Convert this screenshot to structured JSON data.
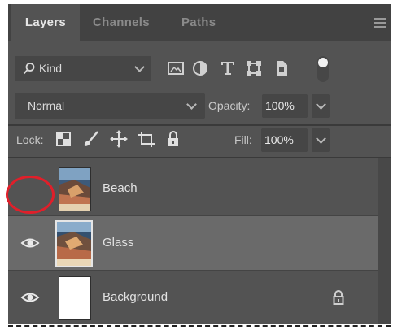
{
  "tabs": {
    "layers": "Layers",
    "channels": "Channels",
    "paths": "Paths"
  },
  "filter": {
    "kind_label": "Kind",
    "icons": [
      "image-filter-icon",
      "adjustment-filter-icon",
      "type-filter-icon",
      "shape-filter-icon",
      "smart-object-filter-icon"
    ]
  },
  "blend": {
    "mode": "Normal",
    "opacity_label": "Opacity:",
    "opacity_value": "100%"
  },
  "lock": {
    "label": "Lock:",
    "fill_label": "Fill:",
    "fill_value": "100%"
  },
  "layers": [
    {
      "name": "Beach",
      "visible": false,
      "selected": false,
      "locked": false
    },
    {
      "name": "Glass",
      "visible": true,
      "selected": true,
      "locked": false
    },
    {
      "name": "Background",
      "visible": true,
      "selected": false,
      "locked": true
    }
  ],
  "colors": {
    "panel_bg": "#535353",
    "tab_bar_bg": "#424242",
    "selected_row_bg": "#6a6a6a",
    "annotation_circle": "#e01f2a"
  }
}
